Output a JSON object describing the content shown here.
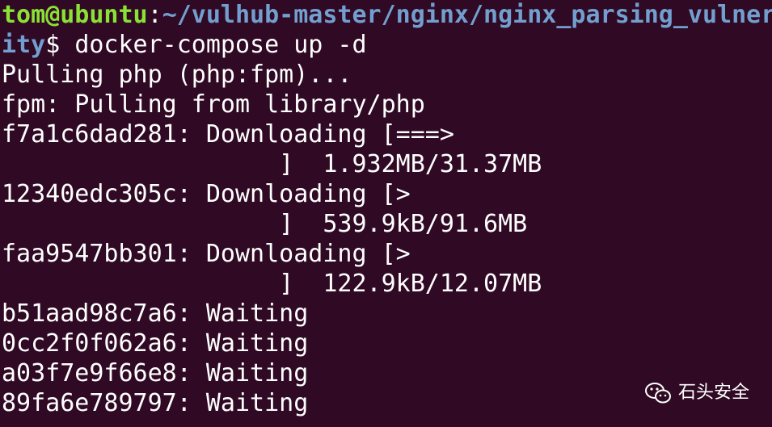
{
  "terminal": {
    "prompt_user": "tom@ubuntu",
    "prompt_sep": ":",
    "prompt_path_part1": "~/vulhub-master/nginx/nginx_parsing_vulner",
    "prompt_path_part2": "ity",
    "prompt_symbol": "$ ",
    "command": "docker-compose up -d",
    "lines": [
      "Pulling php (php:fpm)...",
      "fpm: Pulling from library/php",
      "f7a1c6dad281: Downloading [===>",
      "                   ]  1.932MB/31.37MB",
      "12340edc305c: Downloading [>",
      "                   ]  539.9kB/91.6MB",
      "faa9547bb301: Downloading [>",
      "                   ]  122.9kB/12.07MB",
      "b51aad98c7a6: Waiting",
      "0cc2f0f062a6: Waiting",
      "a03f7e9f66e8: Waiting",
      "89fa6e789797: Waiting"
    ]
  },
  "watermark": {
    "text": "石头安全",
    "icon": "wechat-icon"
  },
  "colors": {
    "background": "#300a24",
    "user": "#8ae234",
    "path": "#729fcf",
    "text": "#ffffff"
  }
}
